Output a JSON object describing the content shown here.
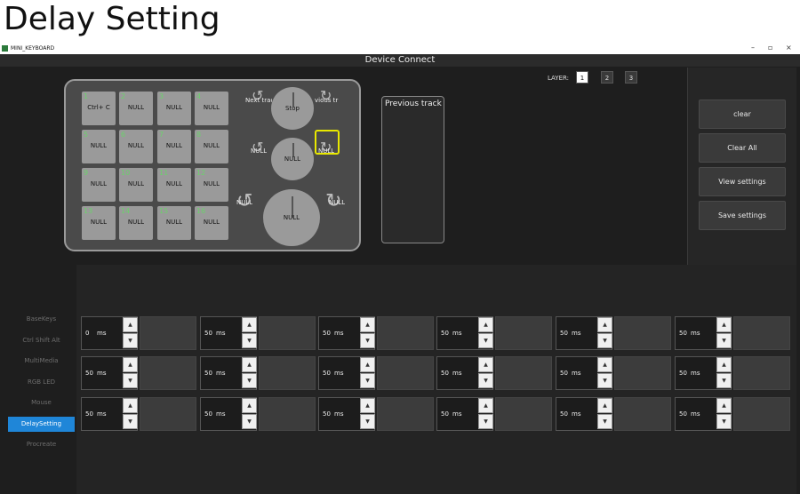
{
  "heading": "Delay Setting",
  "window": {
    "title": "MINI_KEYBOARD",
    "controls": [
      "–",
      "▫",
      "×"
    ],
    "connect_label": "Device Connect"
  },
  "layer": {
    "label": "LAYER:",
    "options": [
      "1",
      "2",
      "3"
    ],
    "selected": "1"
  },
  "actions": {
    "clear": "clear",
    "clear_all": "Clear All",
    "view_settings": "View settings",
    "save_settings": "Save settings"
  },
  "keypad": {
    "keys": [
      {
        "num": "1",
        "label": "Ctrl+ C"
      },
      {
        "num": "2",
        "label": "NULL"
      },
      {
        "num": "3",
        "label": "NULL"
      },
      {
        "num": "4",
        "label": "NULL"
      },
      {
        "num": "5",
        "label": "NULL"
      },
      {
        "num": "6",
        "label": "NULL"
      },
      {
        "num": "7",
        "label": "NULL"
      },
      {
        "num": "8",
        "label": "NULL"
      },
      {
        "num": "9",
        "label": "NULL"
      },
      {
        "num": "10",
        "label": "NULL"
      },
      {
        "num": "11",
        "label": "NULL"
      },
      {
        "num": "12",
        "label": "NULL"
      },
      {
        "num": "13",
        "label": "NULL"
      },
      {
        "num": "14",
        "label": "NULL"
      },
      {
        "num": "15",
        "label": "NULL"
      },
      {
        "num": "16",
        "label": "NULL"
      }
    ],
    "knob1": {
      "center": "Stop",
      "left": "Next trac",
      "right": "vious tr"
    },
    "knob2": {
      "center": "NULL",
      "left": "NULL",
      "right": "NULL"
    },
    "knob3": {
      "center": "NULL",
      "left": "NULL",
      "right": "NULL"
    }
  },
  "preview": {
    "text": "Previous track"
  },
  "sidebar": {
    "items": [
      "BaseKeys",
      "Ctrl Shift Alt",
      "MultiMedia",
      "RGB LED",
      "Mouse",
      "DelaySetting",
      "Procreate"
    ],
    "active": "DelaySetting"
  },
  "delay": {
    "unit": "ms",
    "up": "▲",
    "down": "▼",
    "rows": [
      [
        "0",
        "50",
        "50",
        "50",
        "50",
        "50"
      ],
      [
        "50",
        "50",
        "50",
        "50",
        "50",
        "50"
      ],
      [
        "50",
        "50",
        "50",
        "50",
        "50",
        "50"
      ]
    ]
  }
}
